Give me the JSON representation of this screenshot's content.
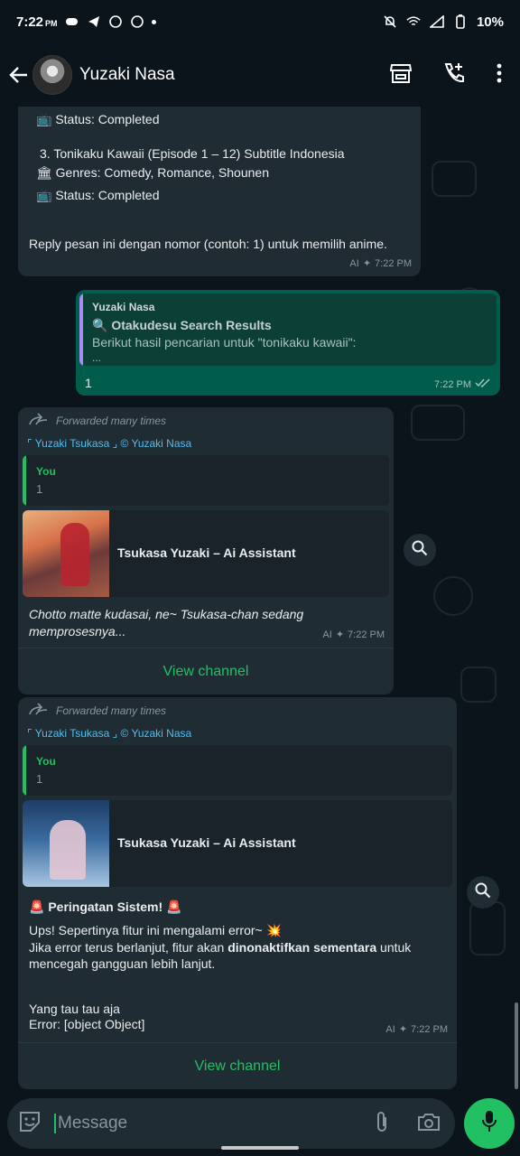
{
  "status_bar": {
    "time": "7:22",
    "ampm": "PM",
    "battery": "10%"
  },
  "header": {
    "contact_name": "Yuzaki Nasa"
  },
  "messages": {
    "msg1": {
      "line1": "📺 Status: Completed",
      "line2": "3. Tonikaku Kawaii (Episode 1 – 12) Subtitle Indonesia",
      "line3": "🏛 Genres: Comedy, Romance, Shounen",
      "line4": "📺 Status: Completed",
      "line5": "Reply pesan ini dengan nomor (contoh: 1) untuk memilih anime.",
      "ai": "AI",
      "time": "7:22 PM"
    },
    "msg2": {
      "quote_author": "Yuzaki Nasa",
      "quote_title": "🔍 Otakudesu Search Results",
      "quote_line": "Berikut hasil pencarian untuk \"tonikaku kawaii\":",
      "quote_more": "...",
      "text": "1",
      "time": "7:22 PM"
    },
    "msg3": {
      "forwarded": "Forwarded many times",
      "channel": "⌜ Yuzaki Tsukasa ⌟ © Yuzaki Nasa",
      "quote_author": "You",
      "quote_text": "1",
      "card_title": "Tsukasa Yuzaki – Ai Assistant",
      "text": "Chotto matte kudasai, ne~ Tsukasa-chan sedang memprosesnya...",
      "ai": "AI",
      "time": "7:22 PM",
      "view_channel": "View channel"
    },
    "msg4": {
      "forwarded": "Forwarded many times",
      "channel": "⌜ Yuzaki Tsukasa ⌟ © Yuzaki Nasa",
      "quote_author": "You",
      "quote_text": "1",
      "card_title": "Tsukasa Yuzaki – Ai Assistant",
      "warn_title": "🚨 Peringatan Sistem! 🚨",
      "line1": "Ups! Sepertinya fitur ini mengalami error~ 💥",
      "line2_a": "Jika error terus berlanjut, fitur akan ",
      "line2_b": "dinonaktifkan sementara",
      "line2_c": " untuk",
      "line3": "mencegah gangguan lebih lanjut.",
      "line4": "Yang tau tau aja",
      "line5": "Error: [object Object]",
      "ai": "AI",
      "time": "7:22 PM",
      "view_channel": "View channel"
    }
  },
  "composer": {
    "placeholder": "Message"
  },
  "colors": {
    "accent": "#21c063",
    "incoming": "#202c33",
    "outgoing": "#005c4b",
    "link": "#53bdeb"
  }
}
